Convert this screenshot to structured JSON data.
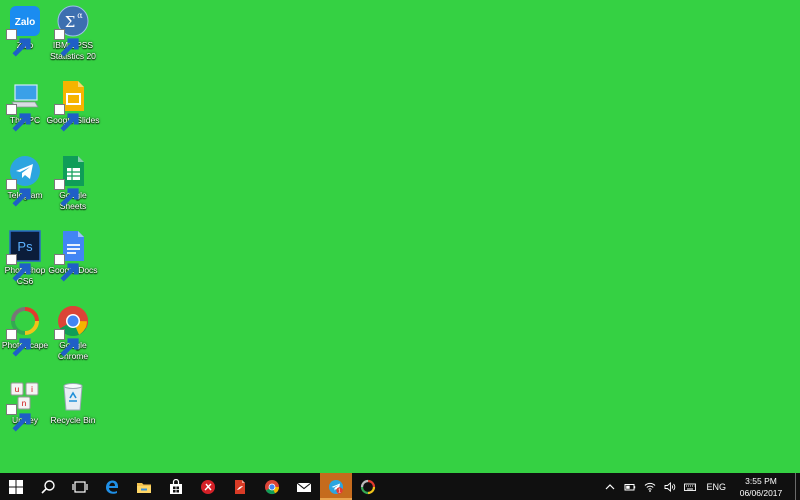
{
  "desktop": {
    "icons": [
      {
        "label": "Zalo",
        "icon": "zalo-icon"
      },
      {
        "label": "IBM SPSS Statistics 20",
        "icon": "spss-icon"
      },
      {
        "label": "This PC",
        "icon": "this-pc-icon"
      },
      {
        "label": "Google Slides",
        "icon": "google-slides-icon"
      },
      {
        "label": "Telegram",
        "icon": "telegram-icon"
      },
      {
        "label": "Google Sheets",
        "icon": "google-sheets-icon"
      },
      {
        "label": "Photoshop CS6",
        "icon": "photoshop-icon"
      },
      {
        "label": "Google Docs",
        "icon": "google-docs-icon"
      },
      {
        "label": "PhotoScape",
        "icon": "photoscape-icon"
      },
      {
        "label": "Google Chrome",
        "icon": "chrome-icon"
      },
      {
        "label": "Unikey",
        "icon": "unikey-icon"
      },
      {
        "label": "Recycle Bin",
        "icon": "recycle-bin-icon"
      }
    ],
    "background_color": "#35d143"
  },
  "taskbar": {
    "pinned": [
      {
        "icon": "windows-start-icon"
      },
      {
        "icon": "search-icon"
      },
      {
        "icon": "task-view-icon"
      },
      {
        "icon": "edge-icon"
      },
      {
        "icon": "file-explorer-icon"
      },
      {
        "icon": "store-icon"
      },
      {
        "icon": "app-red-icon"
      },
      {
        "icon": "pdf-icon"
      },
      {
        "icon": "chrome-icon"
      },
      {
        "icon": "mail-icon"
      },
      {
        "icon": "telegram-icon",
        "active": true,
        "badge": "1"
      },
      {
        "icon": "photoscape-icon"
      }
    ],
    "tray": {
      "icons": [
        "chevron-up-icon",
        "battery-icon",
        "wifi-icon",
        "volume-icon",
        "keyboard-icon"
      ],
      "language": "ENG",
      "time": "3:55 PM",
      "date": "06/06/2017"
    }
  }
}
